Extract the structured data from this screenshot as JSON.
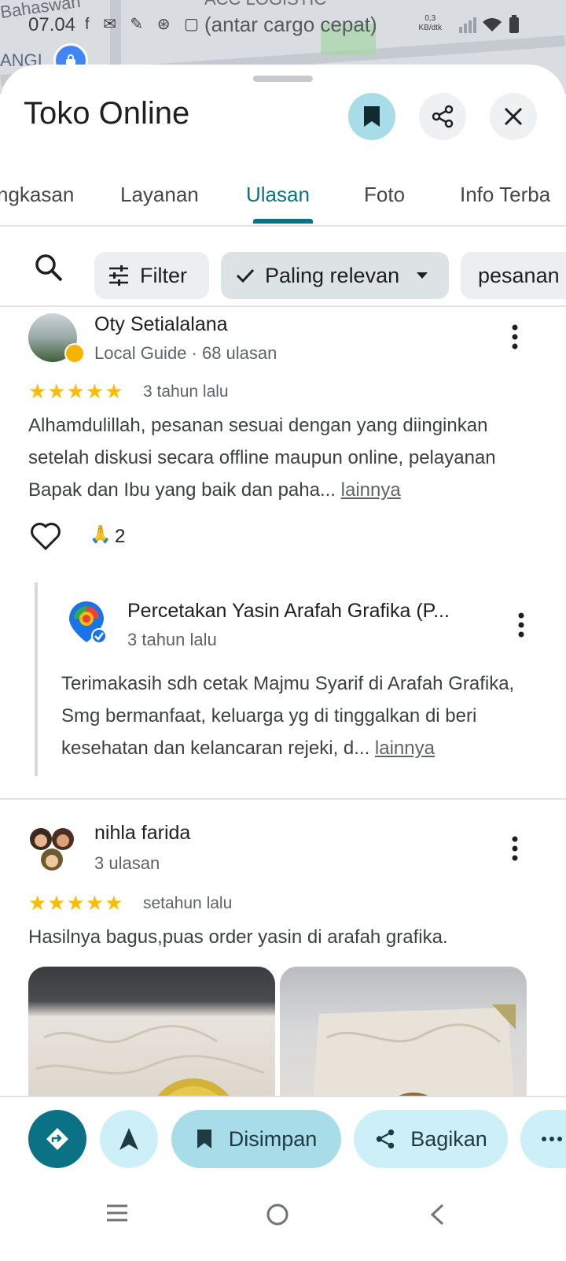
{
  "status_bar": {
    "time": "07.04",
    "notification_icons": "f ✉ ✎ ⊛ ▢",
    "net_speed_value": "0,3",
    "net_speed_unit": "KB/dtk"
  },
  "map": {
    "label_top": "Bahaswan",
    "label_cargo": "(antar cargo cepat)",
    "label_left": "ANGI",
    "label_logistic": "ACC LOGISTIC"
  },
  "place": {
    "title": "Toko Online"
  },
  "tabs": [
    {
      "label": "ngkasan",
      "active": false
    },
    {
      "label": "Layanan",
      "active": false
    },
    {
      "label": "Ulasan",
      "active": true
    },
    {
      "label": "Foto",
      "active": false
    },
    {
      "label": "Info Terba",
      "active": false
    }
  ],
  "filters": {
    "filter_label": "Filter",
    "sort_label": "Paling relevan",
    "chip_pesanan": "pesanan"
  },
  "reviews": [
    {
      "name": "Oty Setialalana",
      "meta": "Local Guide · 68 ulasan",
      "stars": "★★★★★",
      "time": "3 tahun lalu",
      "text": "Alhamdulillah, pesanan sesuai dengan yang diinginkan setelah diskusi secara offline maupun online, pelayanan Bapak dan Ibu yang baik dan paha... ",
      "more": "lainnya",
      "reaction_emoji": "🙏",
      "reaction_count": "2",
      "reply": {
        "name": "Percetakan Yasin Arafah Grafika (P...",
        "time": "3 tahun lalu",
        "text": "Terimakasih sdh cetak  Majmu Syarif di Arafah Grafika, Smg bermanfaat, keluarga yg di tinggalkan di beri kesehatan dan kelancaran rejeki, d... ",
        "more": "lainnya"
      }
    },
    {
      "name": "nihla farida",
      "meta": "3 ulasan",
      "stars": "★★★★★",
      "time": "setahun lalu",
      "text": "Hasilnya bagus,puas order yasin di arafah grafika."
    }
  ],
  "actions": {
    "saved_label": "Disimpan",
    "share_label": "Bagikan"
  },
  "colors": {
    "accent": "#0b7285",
    "save_bg": "#a7dce8",
    "star": "#fbbc04"
  }
}
